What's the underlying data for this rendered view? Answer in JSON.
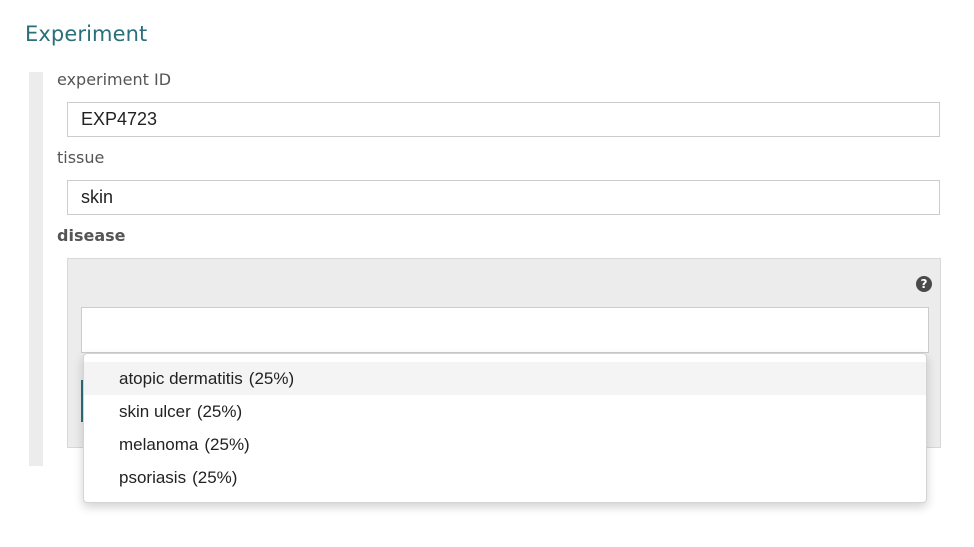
{
  "section": {
    "title": "Experiment"
  },
  "fields": {
    "experiment_id": {
      "label": "experiment ID",
      "value": "EXP4723"
    },
    "tissue": {
      "label": "tissue",
      "value": "skin"
    },
    "disease": {
      "label": "disease",
      "help_icon": "question-circle-icon",
      "input_value": "",
      "options": [
        {
          "label": "atopic dermatitis",
          "pct": "(25%)"
        },
        {
          "label": "skin ulcer",
          "pct": "(25%)"
        },
        {
          "label": "melanoma",
          "pct": "(25%)"
        },
        {
          "label": "psoriasis",
          "pct": "(25%)"
        }
      ]
    }
  },
  "colors": {
    "accent": "#2a6f7a",
    "panel": "#ececec"
  }
}
